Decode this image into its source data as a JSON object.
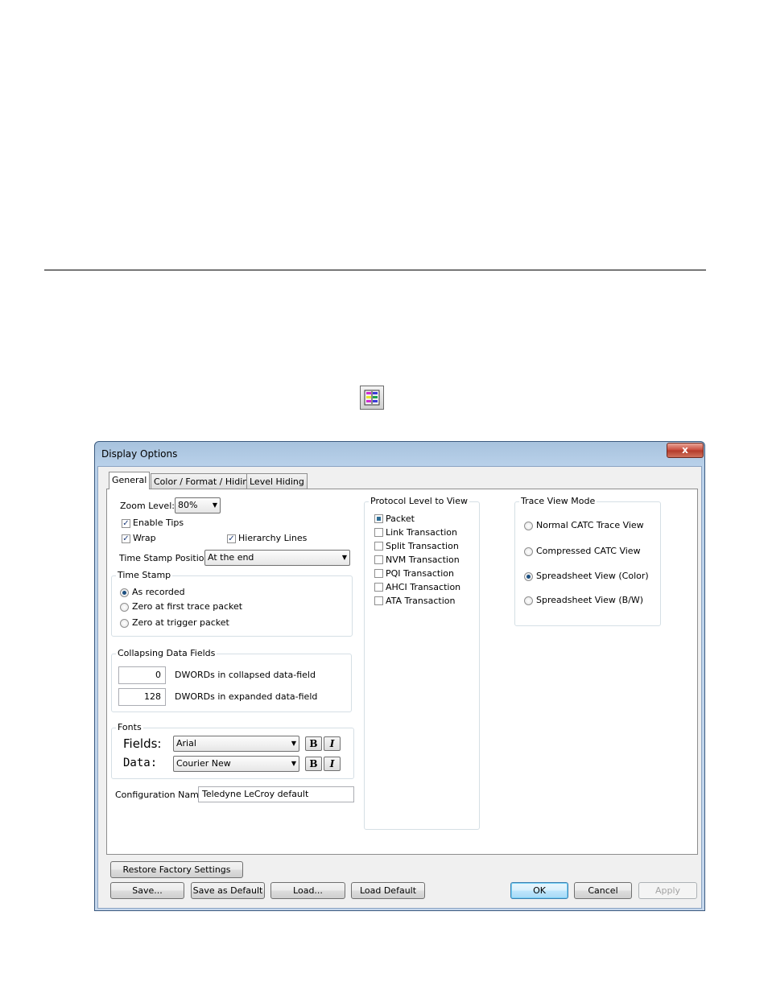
{
  "dialog": {
    "title": "Display Options",
    "close_label": "x",
    "tabs": [
      {
        "label": "General"
      },
      {
        "label": "Color / Format / Hiding"
      },
      {
        "label": "Level Hiding"
      }
    ]
  },
  "general": {
    "zoom_label": "Zoom Level:",
    "zoom_value": "80%",
    "enable_tips": {
      "label": "Enable Tips",
      "checked": true
    },
    "wrap": {
      "label": "Wrap",
      "checked": true
    },
    "hierarchy_lines": {
      "label": "Hierarchy Lines",
      "checked": true
    },
    "timestamp_position_label": "Time Stamp Position:",
    "timestamp_position_value": "At the end",
    "time_stamp": {
      "title": "Time Stamp",
      "options": [
        "As recorded",
        "Zero at first trace packet",
        "Zero at trigger packet"
      ],
      "selected": "As recorded"
    },
    "collapsing": {
      "title": "Collapsing Data Fields",
      "collapsed_value": "0",
      "collapsed_label": "DWORDs in collapsed data-field",
      "expanded_value": "128",
      "expanded_label": "DWORDs in expanded data-field"
    },
    "fonts": {
      "title": "Fonts",
      "fields_label": "Fields:",
      "fields_font": "Arial",
      "data_label": "Data:",
      "data_font": "Courier New",
      "bold_label": "B",
      "italic_label": "I"
    },
    "config_name_label": "Configuration Name:",
    "config_name_value": "Teledyne LeCroy default"
  },
  "protocol_level": {
    "title": "Protocol Level to View",
    "items": [
      {
        "label": "Packet",
        "state": "indeterminate"
      },
      {
        "label": "Link Transaction",
        "state": "unchecked"
      },
      {
        "label": "Split Transaction",
        "state": "unchecked"
      },
      {
        "label": "NVM Transaction",
        "state": "unchecked"
      },
      {
        "label": "PQI Transaction",
        "state": "unchecked"
      },
      {
        "label": "AHCI Transaction",
        "state": "unchecked"
      },
      {
        "label": "ATA Transaction",
        "state": "unchecked"
      }
    ]
  },
  "trace_view_mode": {
    "title": "Trace View Mode",
    "options": [
      "Normal CATC Trace View",
      "Compressed CATC View",
      "Spreadsheet View (Color)",
      "Spreadsheet View (B/W)"
    ],
    "selected": "Spreadsheet View (Color)"
  },
  "buttons": {
    "restore": "Restore Factory Settings",
    "save": "Save...",
    "save_default": "Save as Default",
    "load": "Load...",
    "load_default": "Load Default",
    "ok": "OK",
    "cancel": "Cancel",
    "apply": "Apply"
  },
  "toolbar_icon": "display-options-icon",
  "colors": {
    "title_bar": "#b9d1ea",
    "close_button": "#c7493a",
    "selection": "#1c4f80"
  }
}
